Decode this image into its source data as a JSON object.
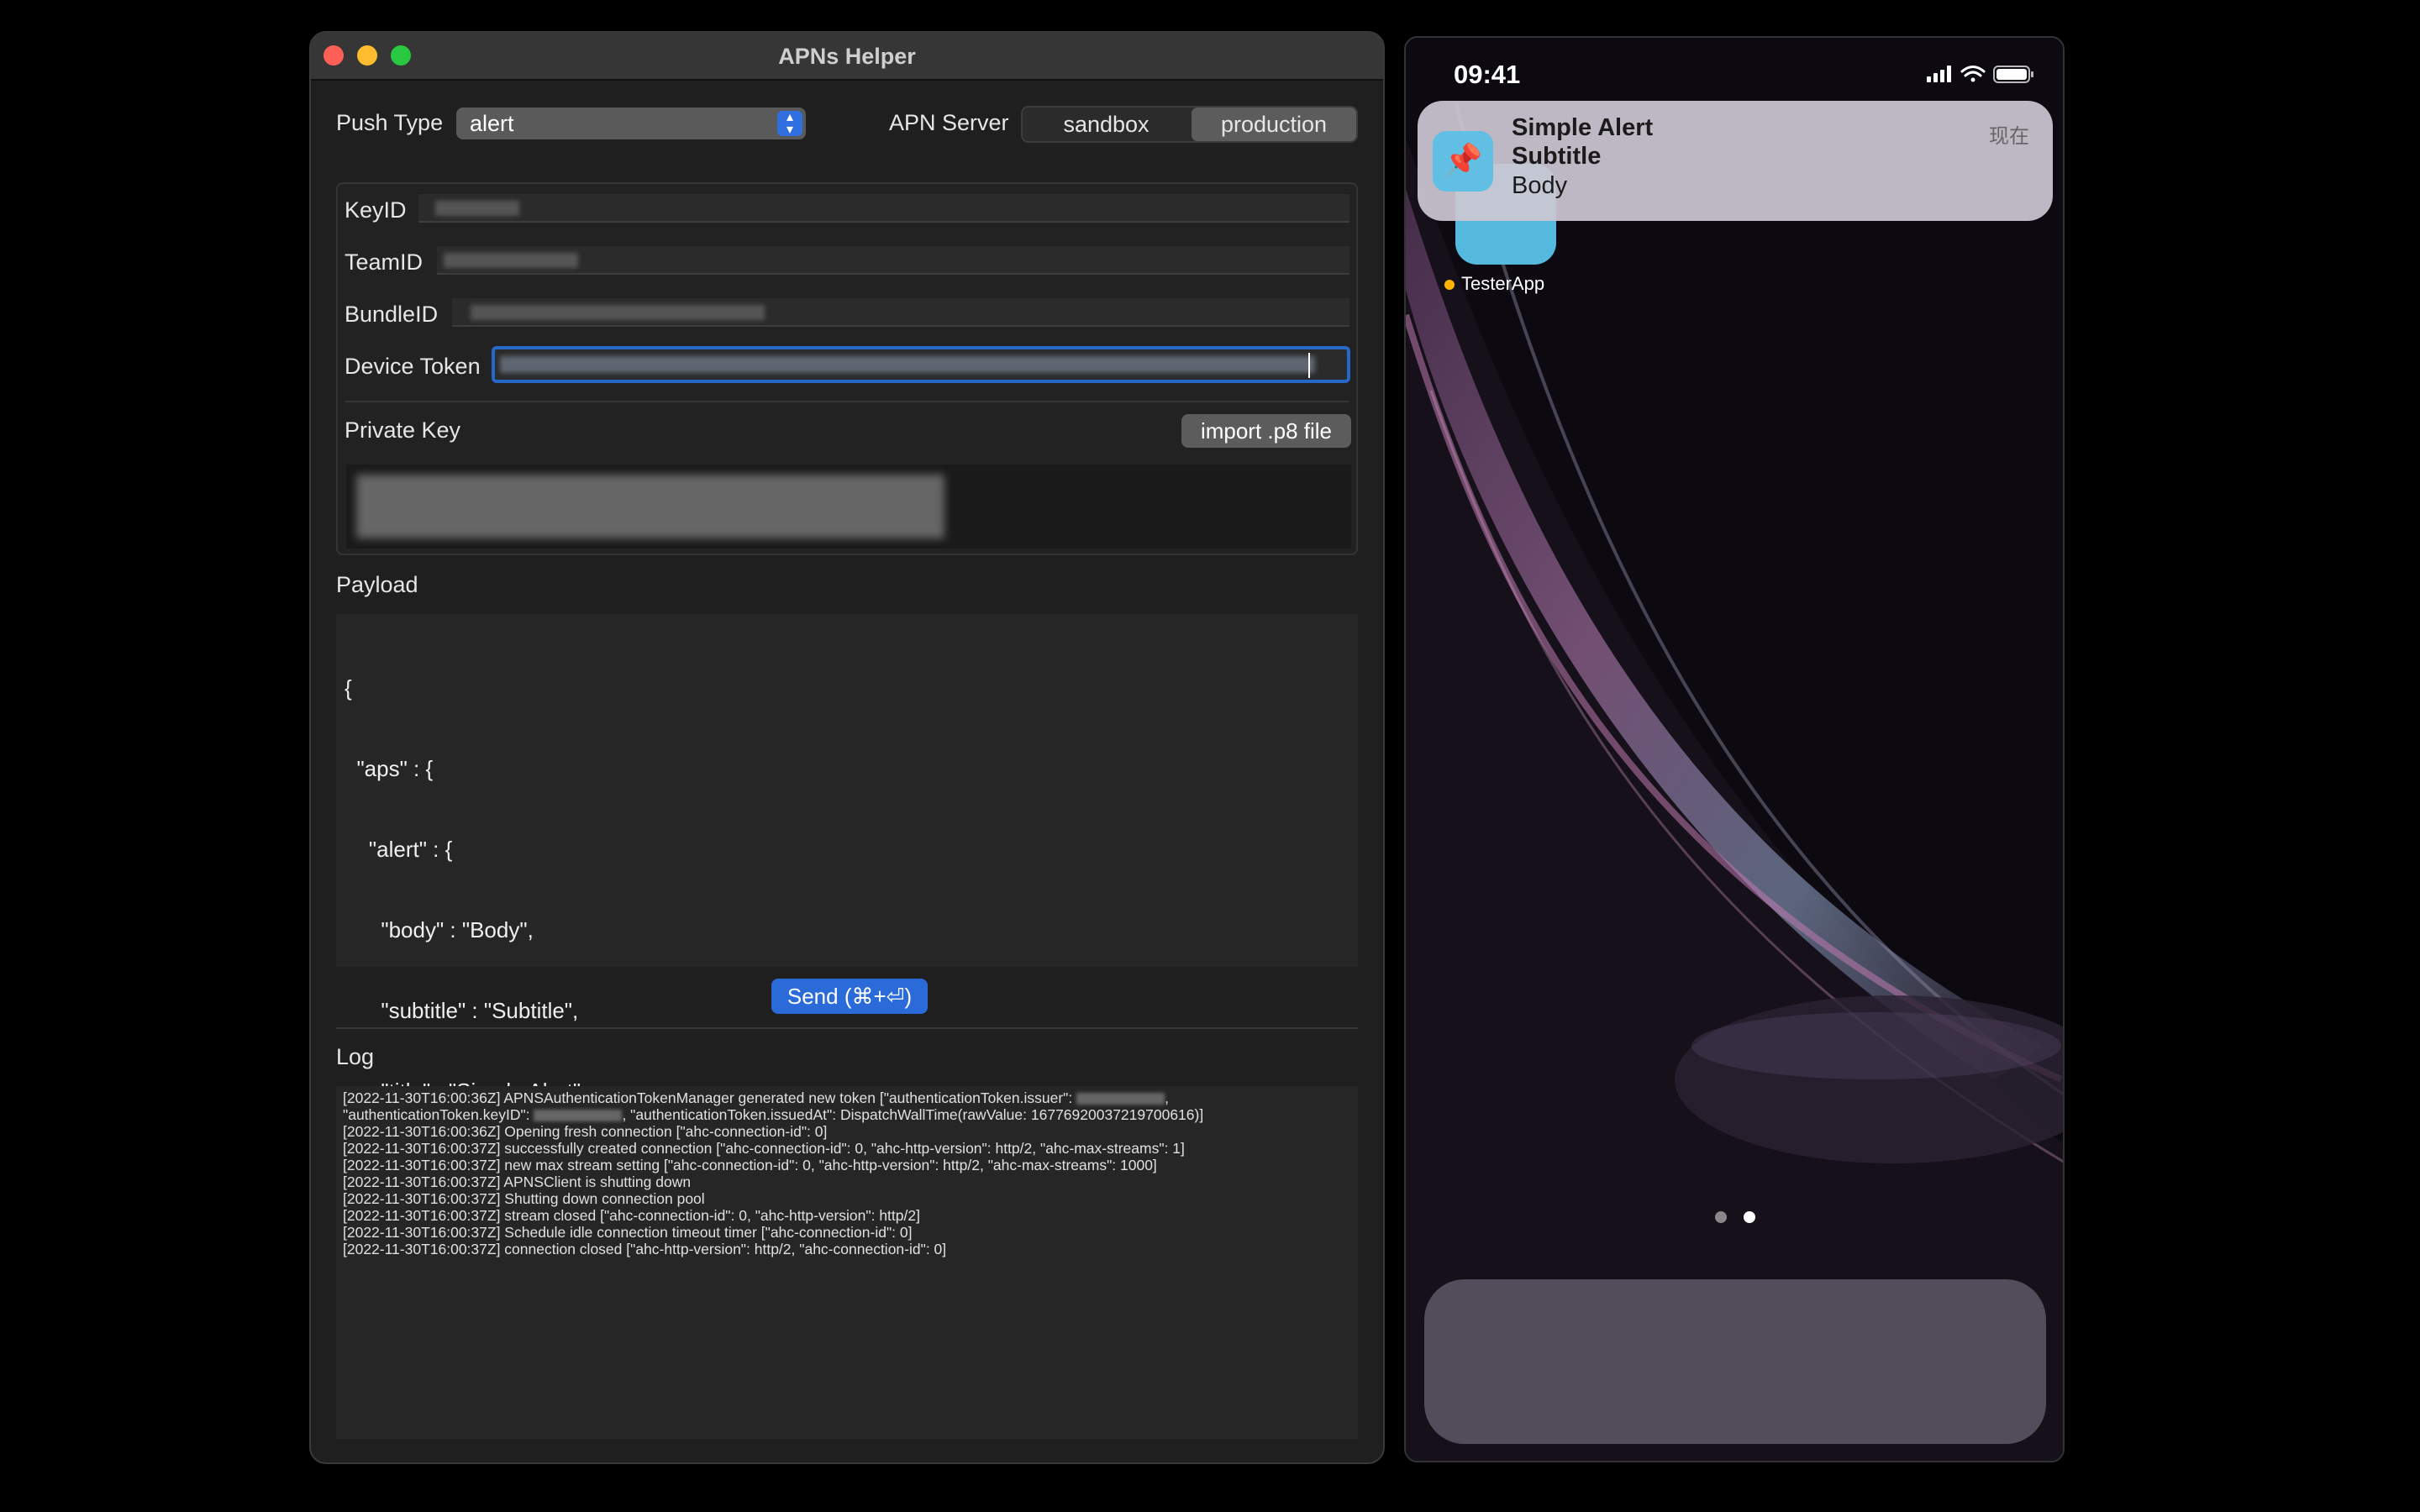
{
  "window": {
    "title": "APNs Helper"
  },
  "push_type": {
    "label": "Push Type",
    "value": "alert"
  },
  "apn_server": {
    "label": "APN Server",
    "options": [
      "sandbox",
      "production"
    ],
    "selected": "production"
  },
  "credentials": {
    "key_id_label": "KeyID",
    "team_id_label": "TeamID",
    "bundle_id_label": "BundleID",
    "device_token_label": "Device Token",
    "private_key_label": "Private Key",
    "import_button": "import .p8 file"
  },
  "payload": {
    "label": "Payload",
    "lines": [
      "{",
      "  \"aps\" : {",
      "    \"alert\" : {",
      "      \"body\" : \"Body\",",
      "      \"subtitle\" : \"Subtitle\",",
      "      \"title\" : \"Simple Alert\"",
      "    }",
      "  }",
      "}"
    ]
  },
  "send_button": "Send (⌘+⏎)",
  "log": {
    "label": "Log",
    "lines": [
      "[2022-11-30T16:00:36Z] APNSAuthenticationTokenManager generated new token [\"authenticationToken.issuer\":",
      "\"authenticationToken.keyID\":",
      ", \"authenticationToken.issuedAt\": DispatchWallTime(rawValue: 16776920037219700616)]",
      "[2022-11-30T16:00:36Z] Opening fresh connection [\"ahc-connection-id\": 0]",
      "[2022-11-30T16:00:37Z] successfully created connection [\"ahc-connection-id\": 0, \"ahc-http-version\": http/2, \"ahc-max-streams\": 1]",
      "[2022-11-30T16:00:37Z] new max stream setting [\"ahc-connection-id\": 0, \"ahc-http-version\": http/2, \"ahc-max-streams\": 1000]",
      "[2022-11-30T16:00:37Z] APNSClient is shutting down",
      "[2022-11-30T16:00:37Z] Shutting down connection pool",
      "[2022-11-30T16:00:37Z] stream closed [\"ahc-connection-id\": 0, \"ahc-http-version\": http/2]",
      "[2022-11-30T16:00:37Z] Schedule idle connection timeout timer [\"ahc-connection-id\": 0]",
      "[2022-11-30T16:00:37Z] connection closed [\"ahc-http-version\": http/2, \"ahc-connection-id\": 0]"
    ]
  },
  "phone": {
    "time": "09:41",
    "notification": {
      "title": "Simple Alert",
      "subtitle": "Subtitle",
      "body": "Body",
      "time": "现在",
      "icon": "pushpin-icon"
    },
    "app_label": "TesterApp"
  }
}
